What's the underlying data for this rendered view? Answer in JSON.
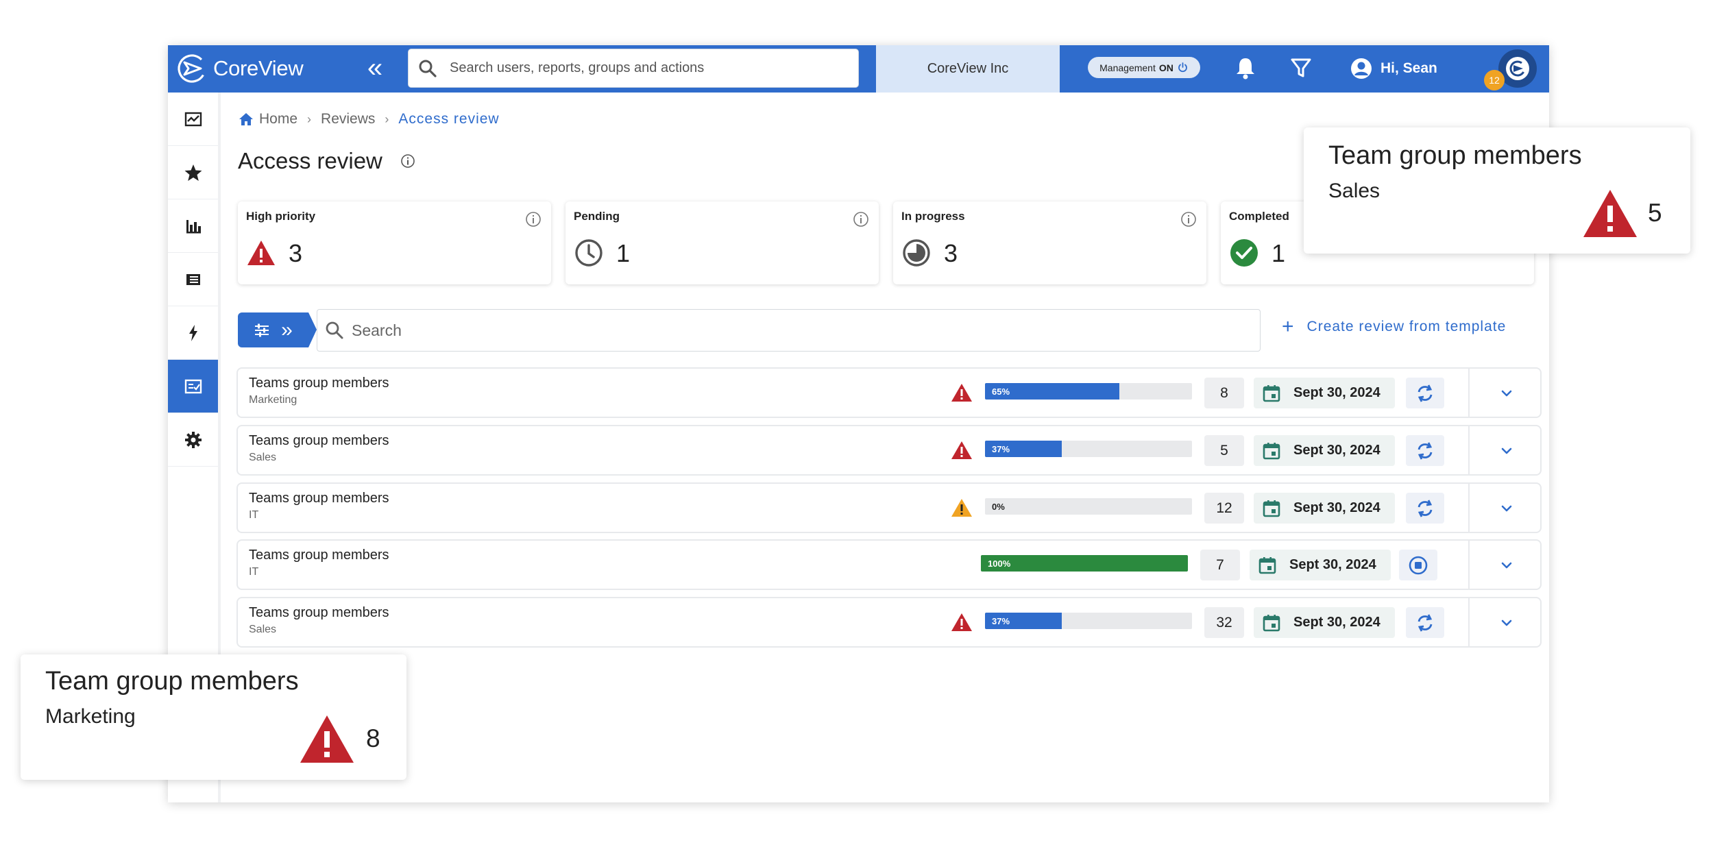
{
  "app": {
    "logo_text": "CoreView"
  },
  "header": {
    "search_placeholder": "Search users, reports, groups and actions",
    "tenant": "CoreView Inc",
    "management_label": "Management",
    "management_state": "ON",
    "greeting": "Hi, Sean",
    "notification_count": "12"
  },
  "sidebar": {
    "items": [
      {
        "icon": "dashboard-icon"
      },
      {
        "icon": "star-icon"
      },
      {
        "icon": "bar-chart-icon"
      },
      {
        "icon": "list-icon"
      },
      {
        "icon": "lightning-icon"
      },
      {
        "icon": "checklist-icon",
        "active": true
      },
      {
        "icon": "gear-icon"
      }
    ]
  },
  "breadcrumb": {
    "home": "Home",
    "reviews": "Reviews",
    "current": "Access review"
  },
  "page": {
    "title": "Access review"
  },
  "cards": [
    {
      "label": "High priority",
      "value": "3",
      "icon": "warning-icon"
    },
    {
      "label": "Pending",
      "value": "1",
      "icon": "clock-icon"
    },
    {
      "label": "In progress",
      "value": "3",
      "icon": "progress-pie-icon"
    },
    {
      "label": "Completed",
      "value": "1",
      "icon": "check-circle-icon"
    }
  ],
  "toolbar": {
    "search_placeholder": "Search",
    "create_label": "Create review from template"
  },
  "reviews": [
    {
      "title": "Teams group members",
      "group": "Marketing",
      "warning": "red",
      "progress": 0.65,
      "progress_label": "65%",
      "count": "8",
      "date": "Sept 30, 2024",
      "status": "running"
    },
    {
      "title": "Teams group members",
      "group": "Sales",
      "warning": "red",
      "progress": 0.37,
      "progress_label": "37%",
      "count": "5",
      "date": "Sept 30, 2024",
      "status": "running"
    },
    {
      "title": "Teams group members",
      "group": "IT",
      "warning": "orange",
      "progress": 0,
      "progress_label": "0%",
      "count": "12",
      "date": "Sept 30, 2024",
      "status": "running"
    },
    {
      "title": "Teams group members",
      "group": "IT",
      "warning": "none",
      "progress": 1,
      "progress_label": "100%",
      "count": "7",
      "date": "Sept 30, 2024",
      "status": "stopped"
    },
    {
      "title": "Teams group members",
      "group": "Sales",
      "warning": "red",
      "progress": 0.37,
      "progress_label": "37%",
      "count": "32",
      "date": "Sept 30, 2024",
      "status": "running"
    }
  ],
  "callouts": [
    {
      "title": "Team group members",
      "subtitle": "Sales",
      "value": "5"
    },
    {
      "title": "Team group members",
      "subtitle": "Marketing",
      "value": "8"
    }
  ],
  "colors": {
    "brand": "#2f6ccc",
    "danger": "#c0252d",
    "warning": "#f0a323",
    "success": "#2b8a3e"
  }
}
